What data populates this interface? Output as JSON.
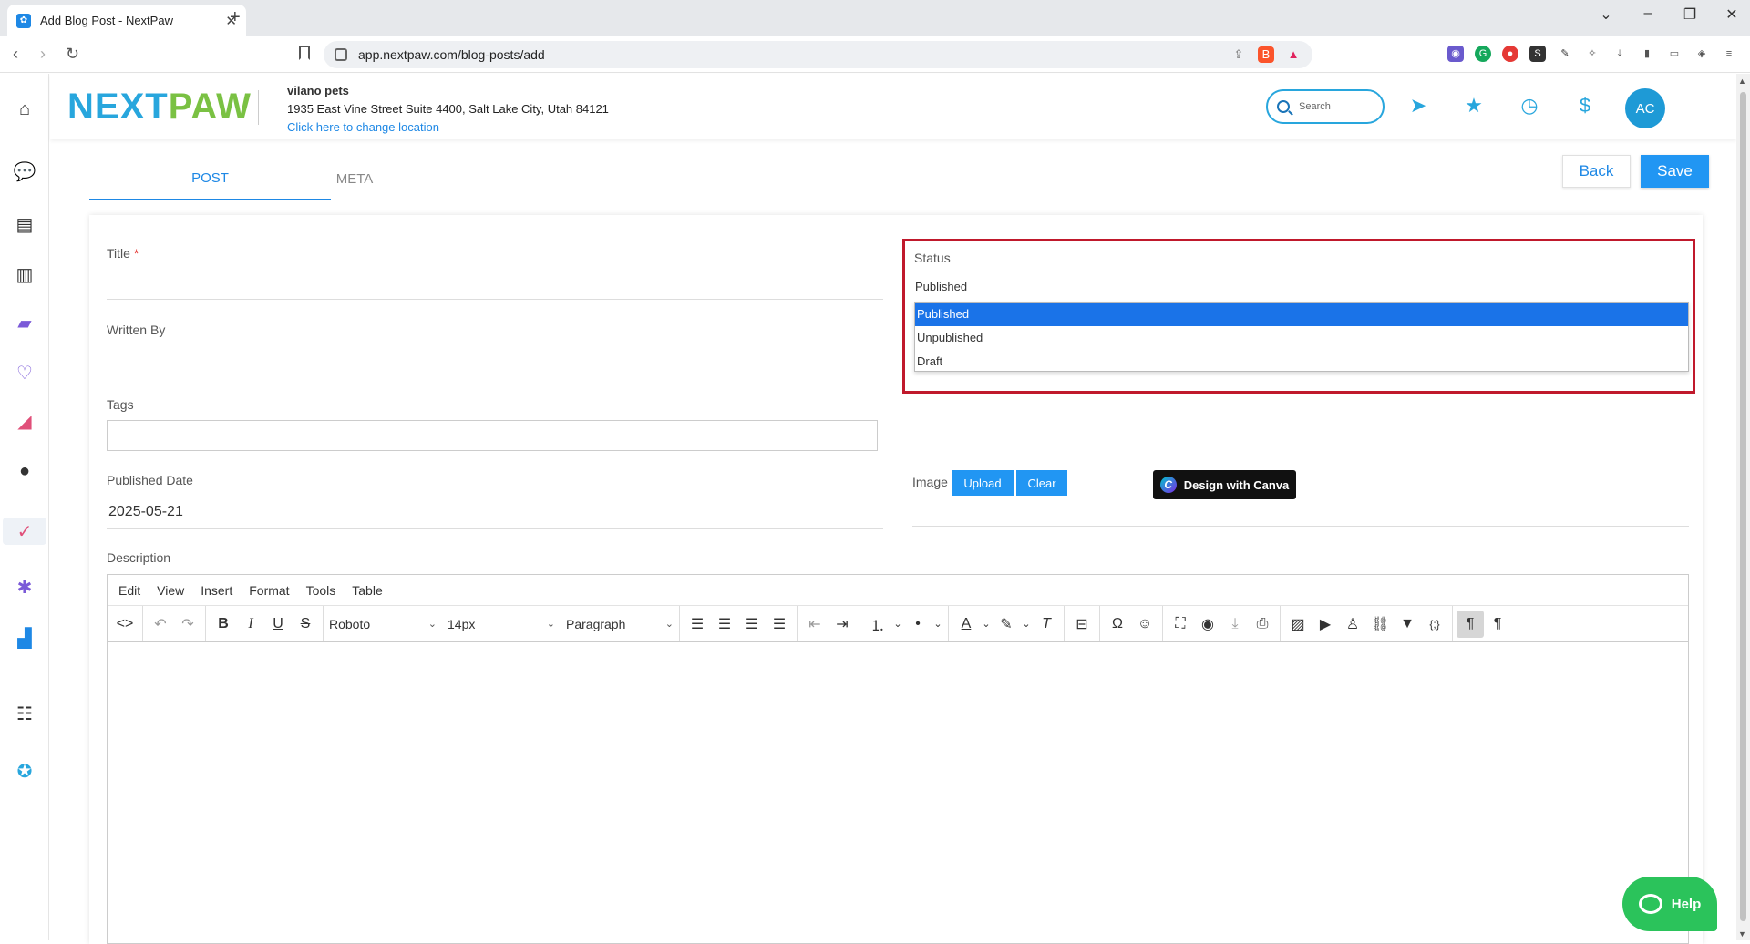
{
  "browser": {
    "tab_title": "Add Blog Post - NextPaw",
    "url": "app.nextpaw.com/blog-posts/add"
  },
  "header": {
    "logo_next": "NEXT",
    "logo_paw": "PAW",
    "business_name": "vilano pets",
    "business_address": "1935 East Vine Street Suite 4400, Salt Lake City, Utah 84121",
    "change_location": "Click here to change location",
    "search_placeholder": "Search",
    "avatar_initials": "AC"
  },
  "tabs": [
    "POST",
    "META"
  ],
  "actions": {
    "back": "Back",
    "save": "Save"
  },
  "form": {
    "title_label": "Title",
    "required_mark": "*",
    "written_by_label": "Written By",
    "tags_label": "Tags",
    "published_date_label": "Published Date",
    "published_date_value": "2025-05-21",
    "description_label": "Description",
    "status_label": "Status",
    "status_value": "Published",
    "status_options": [
      "Published",
      "Unpublished",
      "Draft"
    ],
    "image_label": "Image",
    "upload_label": "Upload",
    "clear_label": "Clear",
    "canva_label": "Design with Canva"
  },
  "editor": {
    "menu": [
      "Edit",
      "View",
      "Insert",
      "Format",
      "Tools",
      "Table"
    ],
    "font_family": "Roboto",
    "font_size": "14px",
    "block_format": "Paragraph"
  },
  "help_label": "Help",
  "colors": {
    "brand_blue": "#28a6dd",
    "brand_green": "#7ac143",
    "primary": "#2196f3",
    "highlight_border": "#c0192c",
    "help_green": "#2bc35b"
  }
}
